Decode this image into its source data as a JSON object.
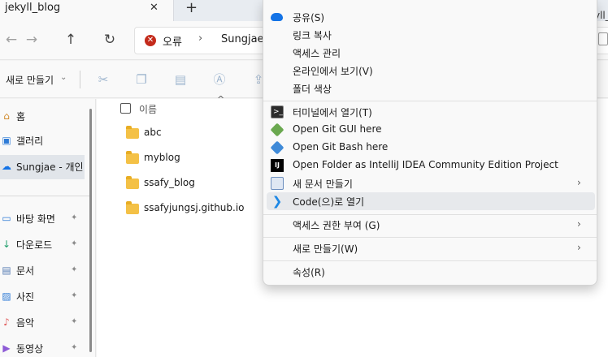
{
  "tab": {
    "title": "jekyll_blog",
    "close": "✕",
    "new": "+",
    "right_fragment": "yll_"
  },
  "address": {
    "back": "←",
    "forward": "→",
    "up": "↑",
    "refresh": "↻",
    "error_label": "오류",
    "separator": "›",
    "user": "Sungjae"
  },
  "toolbar": {
    "new_label": "새로 만들기",
    "new_chevron": "⌄"
  },
  "sidebar": {
    "items": [
      {
        "label": "홈",
        "icon": "home-icon",
        "glyph": "⌂",
        "pinned": false
      },
      {
        "label": "갤러리",
        "icon": "gallery-icon",
        "glyph": "▣",
        "pinned": false
      },
      {
        "label": "Sungjae - 개인",
        "icon": "onedrive-icon",
        "glyph": "☁",
        "pinned": false,
        "active": true
      },
      {
        "label": "바탕 화면",
        "icon": "desktop-icon",
        "glyph": "▭",
        "pinned": true
      },
      {
        "label": "다운로드",
        "icon": "download-icon",
        "glyph": "↓",
        "pinned": true
      },
      {
        "label": "문서",
        "icon": "documents-icon",
        "glyph": "▤",
        "pinned": true
      },
      {
        "label": "사진",
        "icon": "pictures-icon",
        "glyph": "▨",
        "pinned": true
      },
      {
        "label": "음악",
        "icon": "music-icon",
        "glyph": "♪",
        "pinned": true
      },
      {
        "label": "동영상",
        "icon": "videos-icon",
        "glyph": "▶",
        "pinned": true
      }
    ],
    "pin_glyph": "📌"
  },
  "files": {
    "header_name": "이름",
    "sort_glyph": "^",
    "items": [
      {
        "name": "abc"
      },
      {
        "name": "myblog"
      },
      {
        "name": "ssafy_blog"
      },
      {
        "name": "ssafyjungsj.github.io"
      }
    ]
  },
  "context_menu": {
    "items": [
      {
        "label": "공유(S)",
        "icon": "onedrive-share-icon"
      },
      {
        "label": "링크 복사",
        "icon": ""
      },
      {
        "label": "액세스 관리",
        "icon": ""
      },
      {
        "label": "온라인에서 보기(V)",
        "icon": ""
      },
      {
        "label": "폴더 색상",
        "icon": ""
      },
      {
        "label": "터미널에서 열기(T)",
        "icon": "terminal-icon",
        "glyph": ">_"
      },
      {
        "label": "Open Git GUI here",
        "icon": "git-gui-icon"
      },
      {
        "label": "Open Git Bash here",
        "icon": "git-bash-icon"
      },
      {
        "label": "Open Folder as IntelliJ IDEA Community Edition Project",
        "icon": "intellij-icon",
        "glyph": "IJ"
      },
      {
        "label": "새 문서 만들기",
        "icon": "new-document-icon",
        "submenu": true
      },
      {
        "label": "Code(으)로 열기",
        "icon": "vscode-icon",
        "glyph": "❯",
        "hover": true
      },
      {
        "label": "액세스 권한 부여 (G)",
        "icon": "",
        "submenu": true
      },
      {
        "label": "새로 만들기(W)",
        "icon": "",
        "submenu": true
      },
      {
        "label": "속성(R)",
        "icon": ""
      }
    ],
    "chevron": "›"
  },
  "colors": {
    "accent": "#1473e6",
    "folder": "#f4c146",
    "error": "#c42b1c",
    "vscode": "#1e88e5"
  }
}
